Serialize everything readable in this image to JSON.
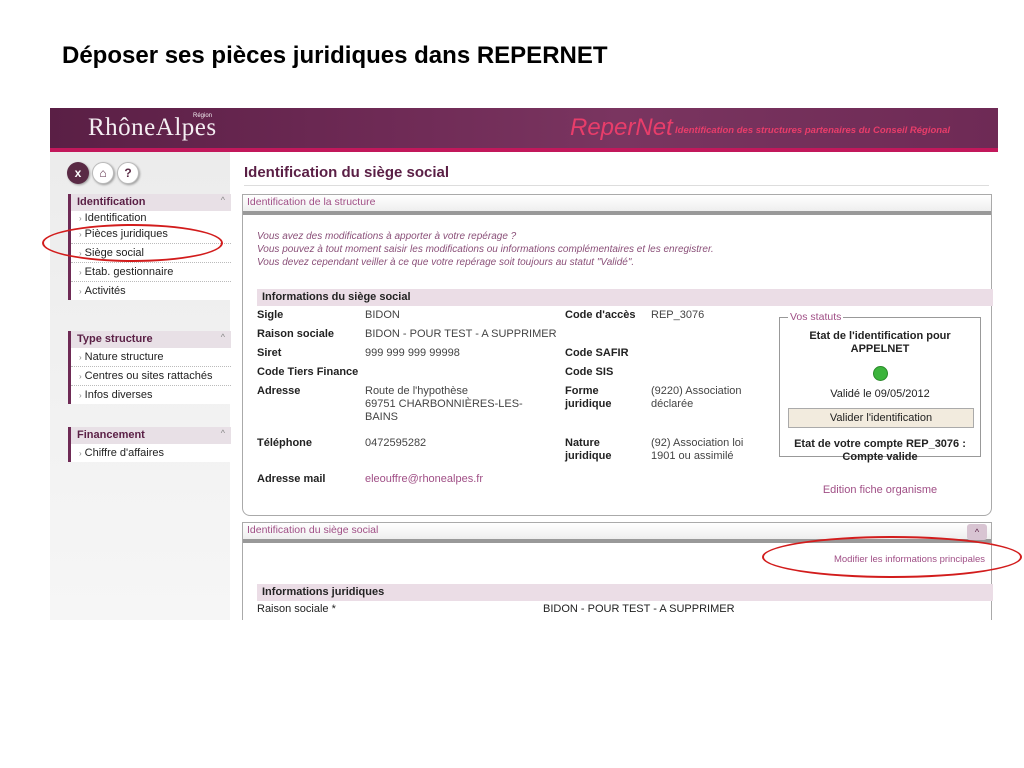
{
  "slide": {
    "title": "Déposer ses pièces juridiques dans REPERNET"
  },
  "banner": {
    "logo": "RhôneAlpes",
    "logo_super": "Région",
    "app_name": "ReperNet",
    "app_subtitle": "Identification des structures partenaires du Conseil Régional"
  },
  "toolbar": {
    "close": "x",
    "home": "⌂",
    "help": "?"
  },
  "sidebar": {
    "sections": [
      {
        "title": "Identification",
        "items": [
          "Identification",
          "Pièces juridiques",
          "Siège social",
          "Etab. gestionnaire",
          "Activités"
        ]
      },
      {
        "title": "Type structure",
        "items": [
          "Nature structure",
          "Centres ou sites rattachés",
          "Infos diverses"
        ]
      },
      {
        "title": "Financement",
        "items": [
          "Chiffre d'affaires"
        ]
      }
    ]
  },
  "main": {
    "title": "Identification du siège social",
    "panel1": {
      "header": "Identification de la structure",
      "intro": [
        "Vous avez des modifications à apporter à votre repérage ?",
        "Vous pouvez à tout moment saisir les modifications ou informations complémentaires et les enregistrer.",
        "Vous devez cependant veiller à ce que votre repérage soit toujours au statut \"Validé\"."
      ],
      "section_title": "Informations du siège social",
      "fields": {
        "sigle_label": "Sigle",
        "sigle": "BIDON",
        "raison_label": "Raison sociale",
        "raison": "BIDON - POUR TEST - A SUPPRIMER",
        "siret_label": "Siret",
        "siret": "999 999 999 99998",
        "tiers_label": "Code Tiers Finance",
        "adresse_label": "Adresse",
        "adresse_1": "Route de l'hypothèse",
        "adresse_2": "69751 CHARBONNIÈRES-LES-",
        "adresse_3": "BAINS",
        "tel_label": "Téléphone",
        "tel": "0472595282",
        "mail_label": "Adresse mail",
        "mail": "eleouffre@rhonealpes.fr",
        "acces_label": "Code d'accès",
        "acces": "REP_3076",
        "safir_label": "Code SAFIR",
        "sis_label": "Code SIS",
        "forme_label_1": "Forme",
        "forme_label_2": "juridique",
        "forme_1": "(9220) Association",
        "forme_2": "déclarée",
        "nature_label_1": "Nature",
        "nature_label_2": "juridique",
        "nature_1": "(92) Association loi",
        "nature_2": "1901 ou assimilé"
      },
      "statuts": {
        "legend": "Vos statuts",
        "etat_1": "Etat de l'identification pour",
        "etat_2": "APPELNET",
        "valide": "Validé le 09/05/2012",
        "button": "Valider l'identification",
        "compte_1": "Etat de votre compte REP_3076 :",
        "compte_2": "Compte valide"
      },
      "edit_link": "Edition fiche organisme"
    },
    "panel2": {
      "header": "Identification du siège social",
      "modif_link": "Modifier les informations principales",
      "section_title": "Informations juridiques",
      "raison_label": "Raison sociale *",
      "raison": "BIDON - POUR TEST - A SUPPRIMER"
    }
  },
  "colors": {
    "banner": "#6e2a55",
    "accent": "#a04f86",
    "highlight": "#d21c1c",
    "status_ok": "#3cb43c"
  }
}
